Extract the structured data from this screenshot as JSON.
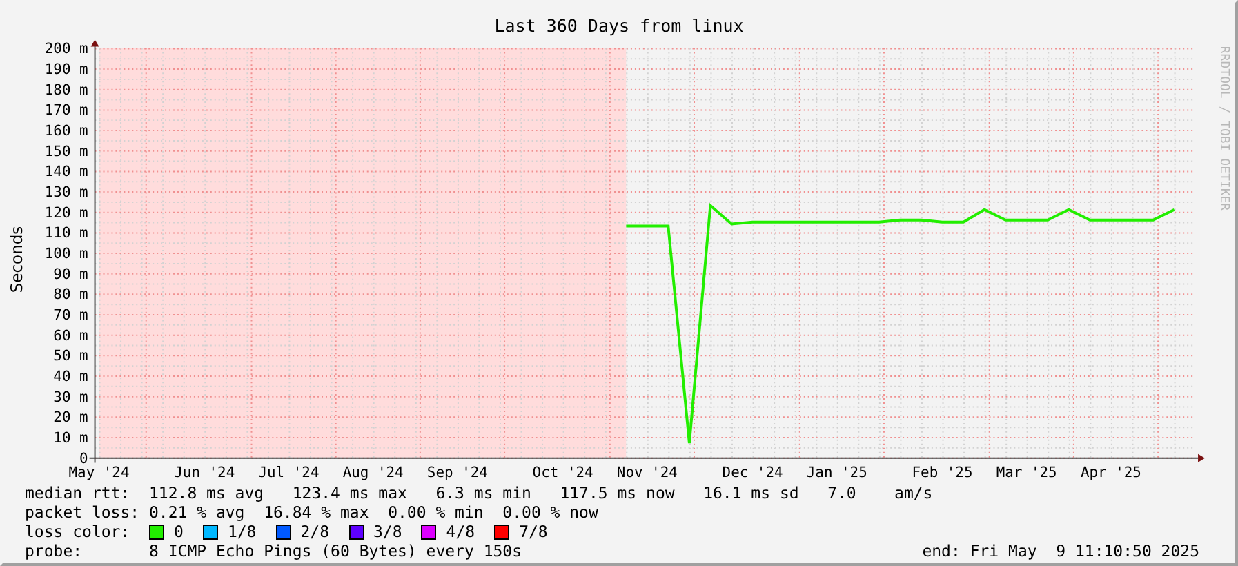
{
  "chart_data": {
    "type": "line",
    "title": "Last 360 Days from linux",
    "ylabel": "Seconds",
    "ylim": [
      0,
      200
    ],
    "categories": [
      "May '24",
      null,
      null,
      null,
      null,
      "Jun '24",
      null,
      null,
      null,
      "Jul '24",
      null,
      null,
      null,
      "Aug '24",
      null,
      null,
      null,
      "Sep '24",
      null,
      null,
      null,
      null,
      "Oct '24",
      null,
      null,
      null,
      "Nov '24",
      null,
      null,
      null,
      null,
      "Dec '24",
      null,
      null,
      null,
      "Jan '25",
      null,
      null,
      null,
      null,
      "Feb '25",
      null,
      null,
      null,
      "Mar '25",
      null,
      null,
      null,
      "Apr '25",
      null,
      null,
      null
    ],
    "yticks": [
      {
        "value": 0,
        "label": "0"
      },
      {
        "value": 10,
        "label": "10 m"
      },
      {
        "value": 20,
        "label": "20 m"
      },
      {
        "value": 30,
        "label": "30 m"
      },
      {
        "value": 40,
        "label": "40 m"
      },
      {
        "value": 50,
        "label": "50 m"
      },
      {
        "value": 60,
        "label": "60 m"
      },
      {
        "value": 70,
        "label": "70 m"
      },
      {
        "value": 80,
        "label": "80 m"
      },
      {
        "value": 90,
        "label": "90 m"
      },
      {
        "value": 100,
        "label": "100 m"
      },
      {
        "value": 110,
        "label": "110 m"
      },
      {
        "value": 120,
        "label": "120 m"
      },
      {
        "value": 130,
        "label": "130 m"
      },
      {
        "value": 140,
        "label": "140 m"
      },
      {
        "value": 150,
        "label": "150 m"
      },
      {
        "value": 160,
        "label": "160 m"
      },
      {
        "value": 170,
        "label": "170 m"
      },
      {
        "value": 180,
        "label": "180 m"
      },
      {
        "value": 190,
        "label": "190 m"
      },
      {
        "value": 200,
        "label": "200 m"
      }
    ],
    "series": [
      {
        "name": "median rtt:",
        "color": "#22ee00",
        "values": [
          null,
          null,
          null,
          null,
          null,
          null,
          null,
          null,
          null,
          null,
          null,
          null,
          null,
          null,
          null,
          null,
          null,
          null,
          null,
          null,
          null,
          null,
          null,
          null,
          null,
          113,
          113,
          113,
          7,
          123,
          114,
          115,
          115,
          115,
          115,
          115,
          115,
          115,
          116,
          116,
          115,
          115,
          121,
          116,
          116,
          116,
          121,
          116,
          116,
          116,
          116,
          121
        ]
      }
    ],
    "grid": true
  },
  "unknown_data_shaded": true,
  "watermark": "RRDTOOL / TOBI OETIKER",
  "legend": {
    "rows": [
      {
        "text": "112.8 ms avg   123.4 ms max   6.3 ms min   117.5 ms now   16.1 ms sd   7.0    am/s"
      },
      {
        "label": "packet loss:",
        "text": "0.21 % avg  16.84 % max  0.00 % min  0.00 % now"
      }
    ],
    "loss_colors": {
      "label": "loss color:",
      "items": [
        {
          "label": "0",
          "color": "#22ee00"
        },
        {
          "label": "1/8",
          "color": "#00b8ff"
        },
        {
          "label": "2/8",
          "color": "#0059ff"
        },
        {
          "label": "3/8",
          "color": "#5e00ff"
        },
        {
          "label": "4/8",
          "color": "#dd00ff"
        },
        {
          "label": "7/8",
          "color": "#ff0000"
        }
      ]
    },
    "probe": {
      "label": "probe:",
      "text": "8 ICMP Echo Pings (60 Bytes) every 150s"
    },
    "end": "end: Fri May  9 11:10:50 2025"
  }
}
